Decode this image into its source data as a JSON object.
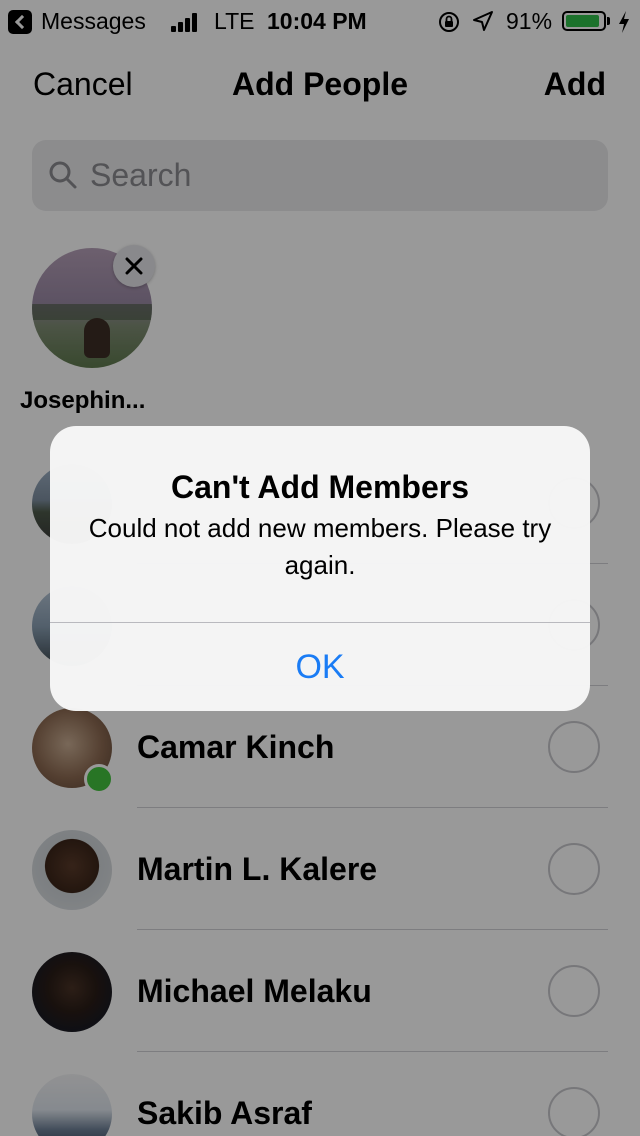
{
  "status_bar": {
    "back_label": "Messages",
    "network": "LTE",
    "time": "10:04 PM",
    "battery_percent": "91%",
    "battery_level": 0.91
  },
  "nav": {
    "cancel_label": "Cancel",
    "title": "Add People",
    "add_label": "Add"
  },
  "search": {
    "placeholder": "Search"
  },
  "selected": [
    {
      "name": "Josephin..."
    }
  ],
  "contacts": [
    {
      "name": "",
      "online": false
    },
    {
      "name": "",
      "online": false
    },
    {
      "name": "Camar Kinch",
      "online": true
    },
    {
      "name": "Martin L. Kalere",
      "online": false
    },
    {
      "name": "Michael Melaku",
      "online": false
    },
    {
      "name": "Sakib Asraf",
      "online": false
    }
  ],
  "alert": {
    "title": "Can't Add Members",
    "message": "Could not add new members. Please try again.",
    "ok_label": "OK"
  },
  "colors": {
    "accent": "#1a7cf5",
    "online": "#44c43f",
    "battery": "#2fbf4a"
  }
}
